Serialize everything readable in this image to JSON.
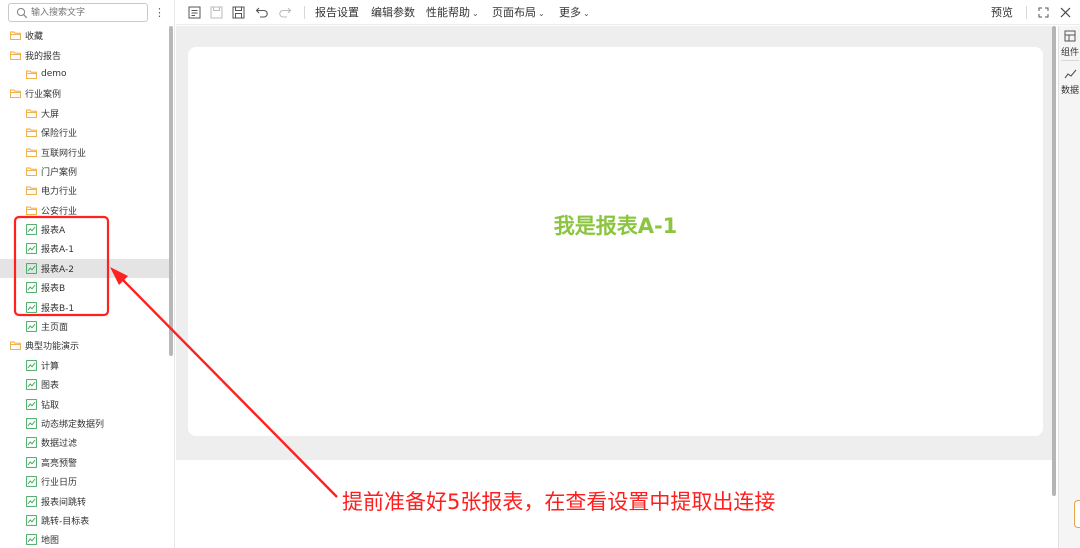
{
  "search": {
    "placeholder": "输入搜索文字"
  },
  "tree": [
    {
      "label": "收藏",
      "icon": "folder-icon",
      "level": 0
    },
    {
      "label": "我的报告",
      "icon": "folder-icon",
      "level": 0
    },
    {
      "label": "demo",
      "icon": "folder-icon",
      "level": 1
    },
    {
      "label": "行业案例",
      "icon": "folder-icon",
      "level": 0
    },
    {
      "label": "大屏",
      "icon": "folder-icon",
      "level": 1
    },
    {
      "label": "保险行业",
      "icon": "folder-icon",
      "level": 1
    },
    {
      "label": "互联网行业",
      "icon": "folder-icon",
      "level": 1
    },
    {
      "label": "门户案例",
      "icon": "folder-icon",
      "level": 1
    },
    {
      "label": "电力行业",
      "icon": "folder-icon",
      "level": 1
    },
    {
      "label": "公安行业",
      "icon": "folder-icon",
      "level": 1
    },
    {
      "label": "报表A",
      "icon": "report-chart-icon",
      "level": 1
    },
    {
      "label": "报表A-1",
      "icon": "report-chart-icon",
      "level": 1
    },
    {
      "label": "报表A-2",
      "icon": "report-chart-icon",
      "level": 1,
      "selected": true
    },
    {
      "label": "报表B",
      "icon": "report-chart-icon",
      "level": 1
    },
    {
      "label": "报表B-1",
      "icon": "report-chart-icon",
      "level": 1
    },
    {
      "label": "主页面",
      "icon": "report-chart-icon",
      "level": 1
    },
    {
      "label": "典型功能演示",
      "icon": "folder-icon",
      "level": 0
    },
    {
      "label": "计算",
      "icon": "report-chart-icon",
      "level": 1
    },
    {
      "label": "图表",
      "icon": "report-chart-icon",
      "level": 1
    },
    {
      "label": "钻取",
      "icon": "report-chart-icon",
      "level": 1
    },
    {
      "label": "动态绑定数据列",
      "icon": "report-chart-icon",
      "level": 1
    },
    {
      "label": "数据过滤",
      "icon": "report-chart-icon",
      "level": 1
    },
    {
      "label": "高亮预警",
      "icon": "report-chart-icon",
      "level": 1
    },
    {
      "label": "行业日历",
      "icon": "report-chart-icon",
      "level": 1
    },
    {
      "label": "报表间跳转",
      "icon": "report-chart-icon",
      "level": 1
    },
    {
      "label": "跳转-目标表",
      "icon": "report-chart-icon",
      "level": 1
    },
    {
      "label": "地图",
      "icon": "report-chart-icon",
      "level": 1
    }
  ],
  "toolbar": {
    "menus": [
      {
        "label": "报告设置",
        "has_dropdown": false
      },
      {
        "label": "编辑参数",
        "has_dropdown": false
      },
      {
        "label": "性能帮助",
        "has_dropdown": true
      },
      {
        "label": "页面布局",
        "has_dropdown": true
      },
      {
        "label": "更多",
        "has_dropdown": true
      }
    ],
    "preview_label": "预览"
  },
  "canvas": {
    "report_title": "我是报表A-1",
    "report_title_color": "#8bc53f"
  },
  "right_panel": {
    "components_label": "组件",
    "data_label": "数据"
  },
  "annotation": {
    "text": "提前准备好5张报表，在查看设置中提取出连接",
    "color": "#ff1e1e"
  },
  "colors": {
    "folder": "#f0a532",
    "report_icon": "#3aa55a",
    "selected_row": "#e4e4e4"
  }
}
